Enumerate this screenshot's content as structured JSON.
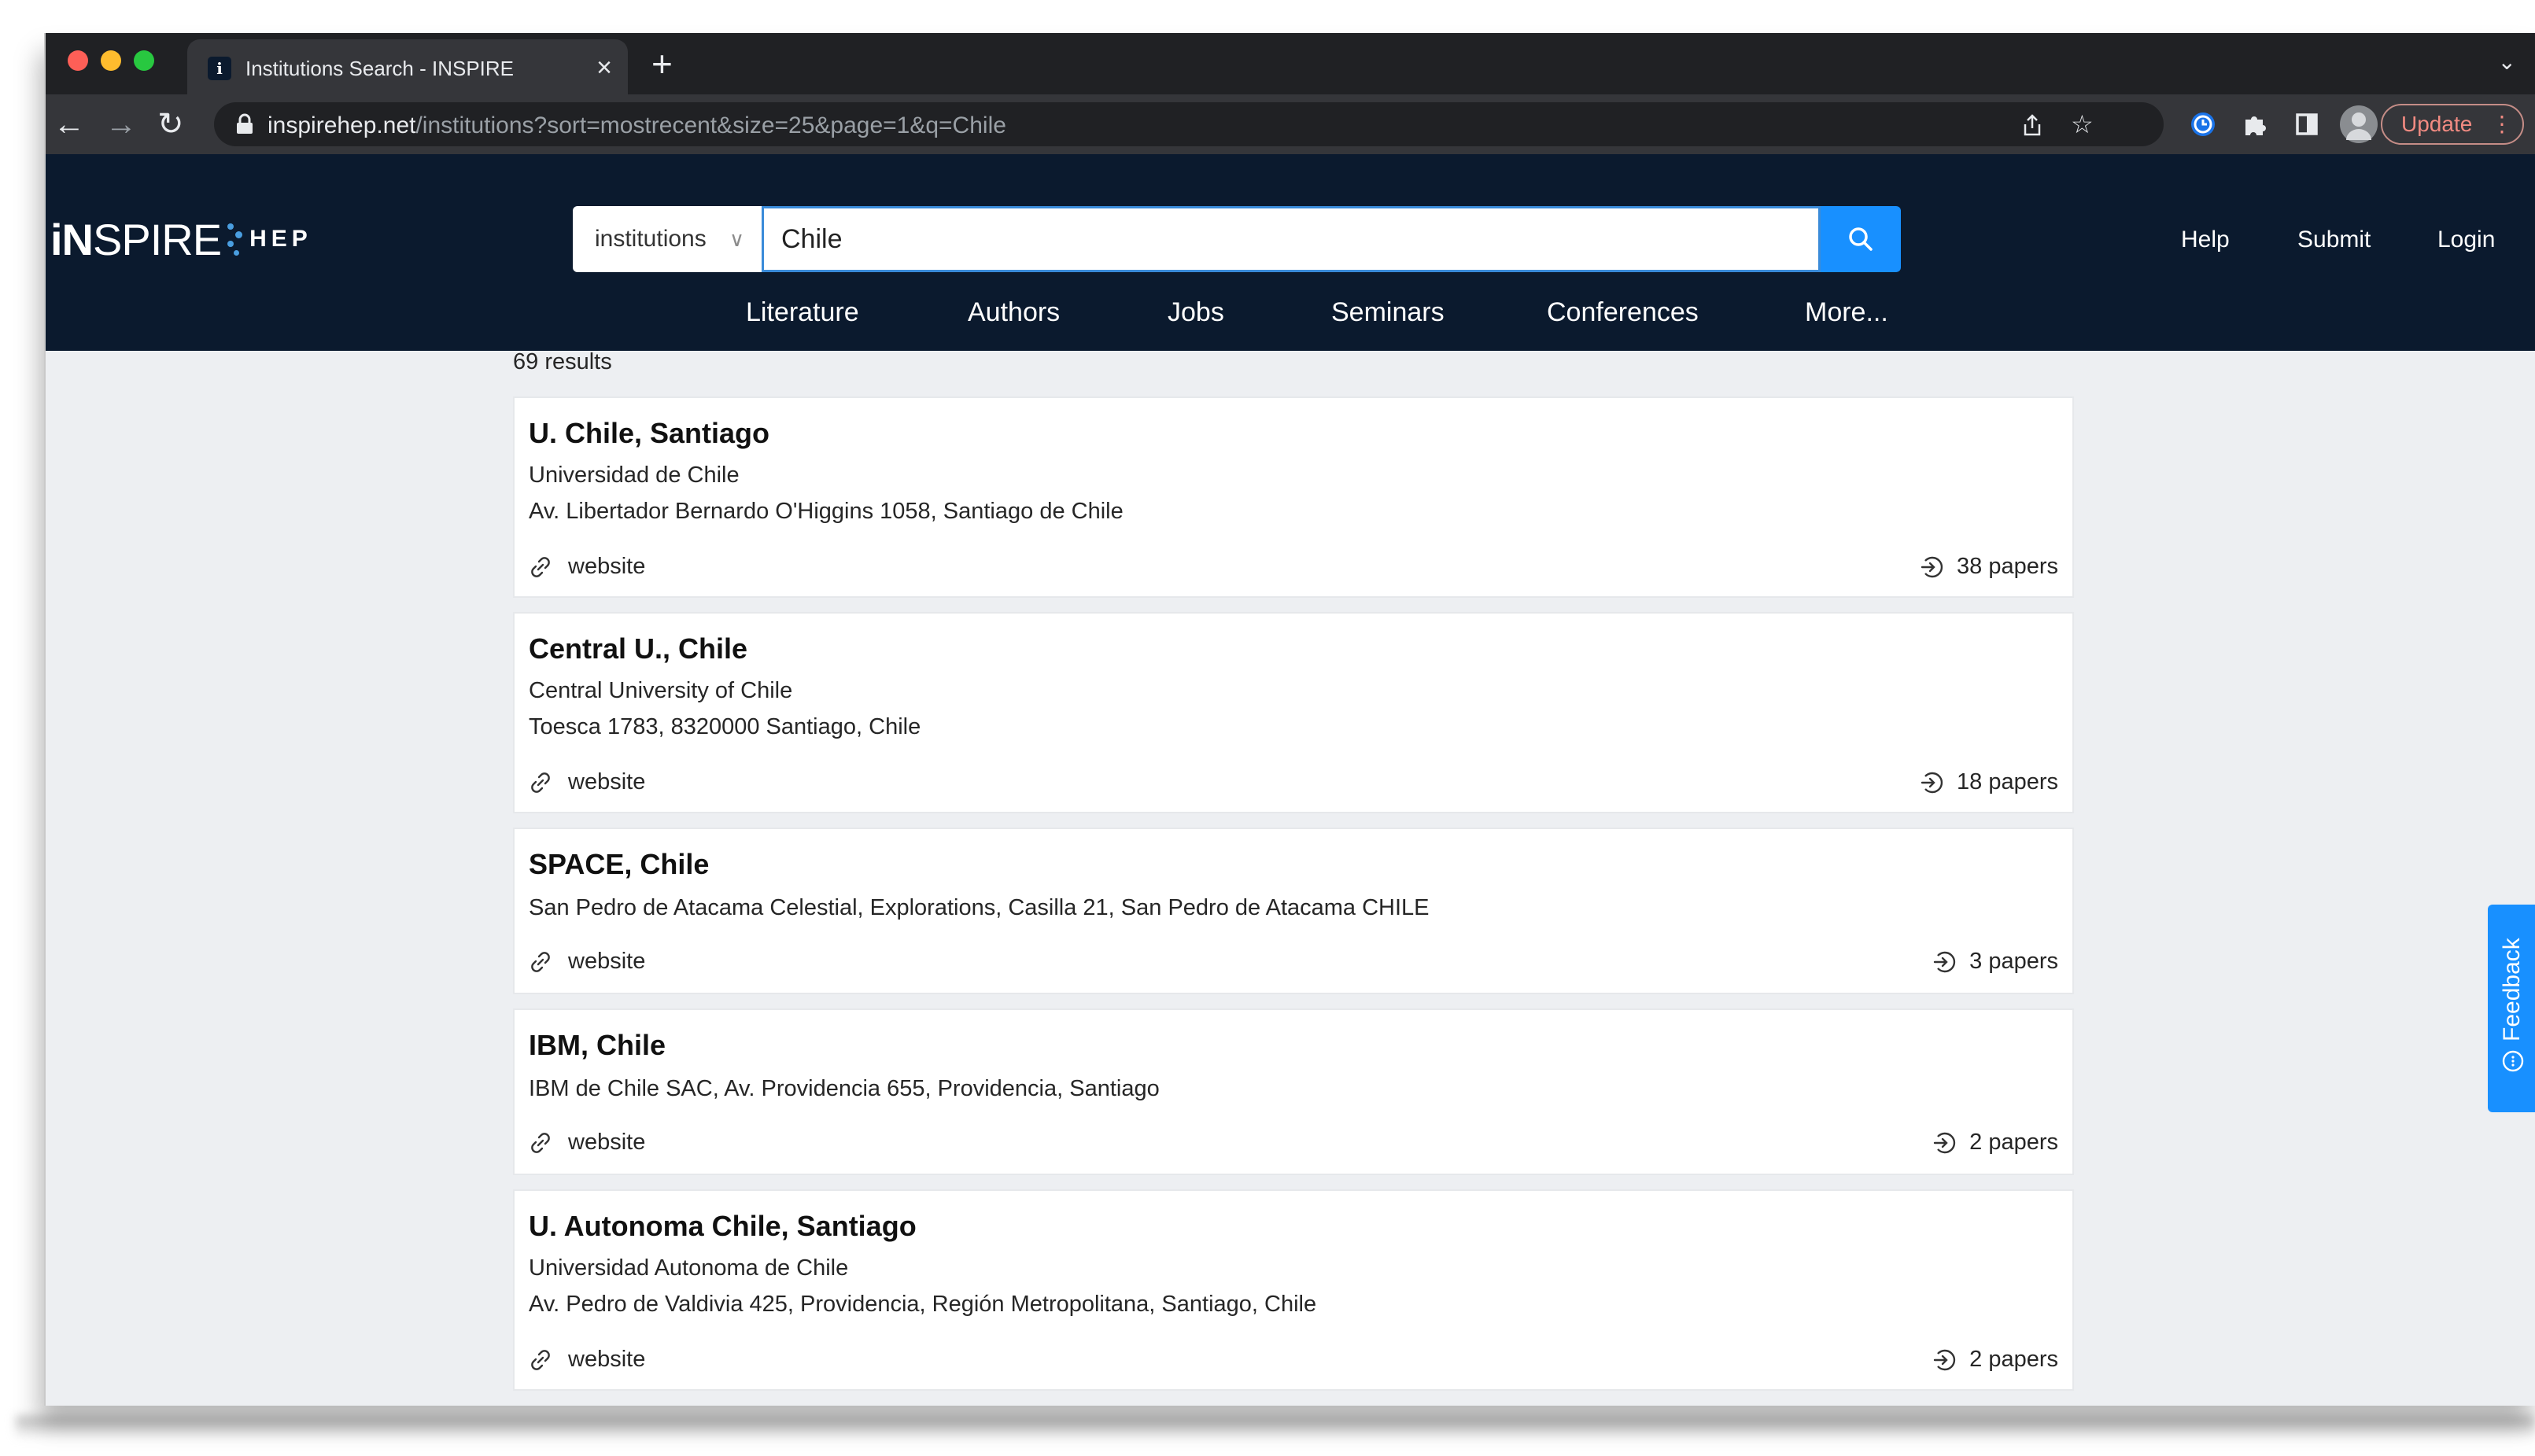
{
  "browser": {
    "tab_title": "Institutions Search - INSPIRE",
    "tab_favicon": "i",
    "close_glyph": "×",
    "newtab_glyph": "+",
    "tabs_menu_glyph": "⌄",
    "url_host": "inspirehep.net",
    "url_path": "/institutions?sort=mostrecent&size=25&page=1&q=Chile",
    "update_label": "Update",
    "update_dots": "⋮",
    "icons": {
      "back": "←",
      "forward": "→",
      "reload": "↻",
      "share": "share-icon",
      "star": "☆",
      "extension": "puzzle-icon",
      "sidepanel": "sidepanel-icon",
      "profile": "avatar"
    }
  },
  "site": {
    "logo_prefix": "iN",
    "logo_suffix": "SPIRE",
    "logo_hep": "HEP",
    "search_scope": "institutions",
    "scope_chevron": "∨",
    "search_query": "Chile",
    "header_links": [
      "Help",
      "Submit",
      "Login"
    ],
    "nav": [
      "Literature",
      "Authors",
      "Jobs",
      "Seminars",
      "Conferences",
      "More..."
    ],
    "brand_color": "#0b1a2e",
    "accent_color": "#1890ff"
  },
  "results": {
    "count_label": "69 results",
    "items": [
      {
        "title": "U. Chile, Santiago",
        "lines": [
          "Universidad de Chile",
          "Av. Libertador Bernardo O'Higgins 1058, Santiago de Chile"
        ],
        "website_label": "website",
        "papers": "38 papers"
      },
      {
        "title": "Central U., Chile",
        "lines": [
          "Central University of Chile",
          "Toesca 1783, 8320000 Santiago, Chile"
        ],
        "website_label": "website",
        "papers": "18 papers"
      },
      {
        "title": "SPACE, Chile",
        "lines": [
          "San Pedro de Atacama Celestial, Explorations, Casilla 21, San Pedro de Atacama CHILE"
        ],
        "website_label": "website",
        "papers": "3 papers"
      },
      {
        "title": "IBM, Chile",
        "lines": [
          "IBM de Chile SAC, Av. Providencia 655, Providencia, Santiago"
        ],
        "website_label": "website",
        "papers": "2 papers"
      },
      {
        "title": "U. Autonoma Chile, Santiago",
        "lines": [
          "Universidad Autonoma de Chile",
          "Av. Pedro de Valdivia 425, Providencia, Región Metropolitana, Santiago, Chile"
        ],
        "website_label": "website",
        "papers": "2 papers"
      }
    ]
  },
  "feedback": {
    "label": "Feedback"
  }
}
